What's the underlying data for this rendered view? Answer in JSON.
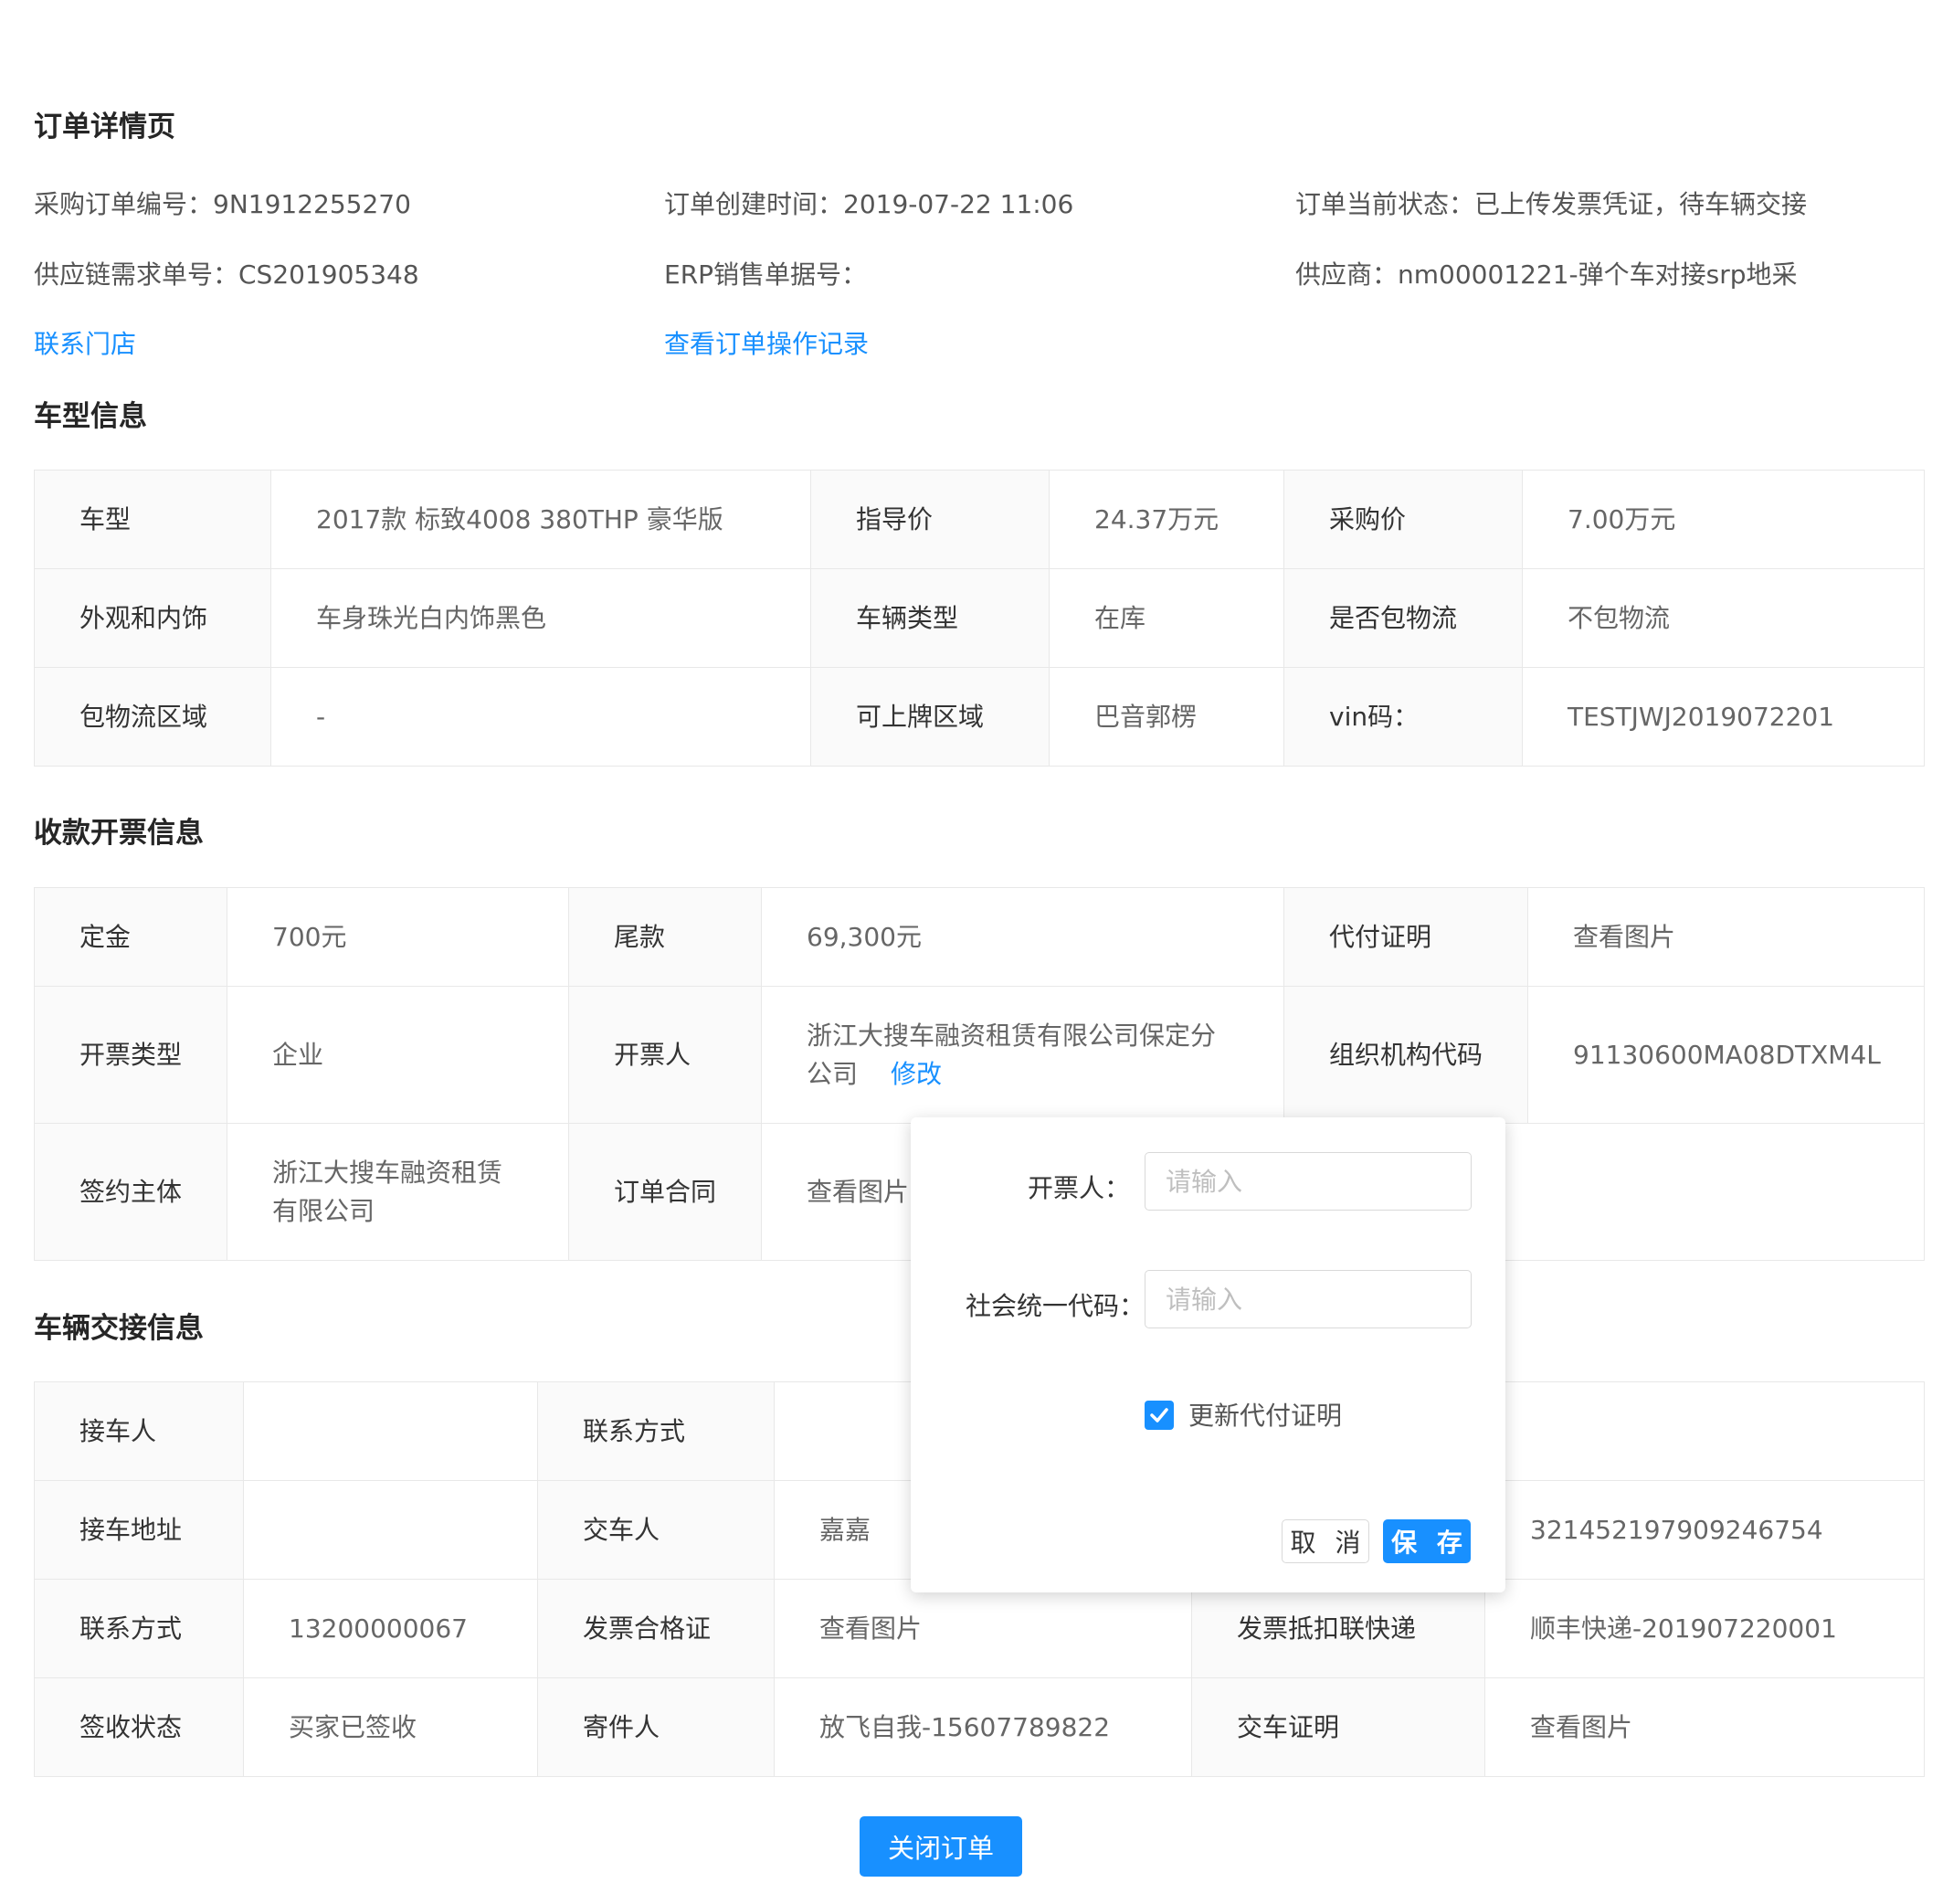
{
  "page": {
    "title": "订单详情页"
  },
  "order": {
    "po_number": "采购订单编号：9N1912255270",
    "created_time": "订单创建时间：2019-07-22 11:06",
    "status": "订单当前状态：已上传发票凭证，待车辆交接",
    "supply_chain_number": "供应链需求单号：CS201905348",
    "erp_number": "ERP销售单据号：",
    "supplier": "供应商：nm00001221-弹个车对接srp地采",
    "contact_store_link": "联系门店",
    "view_log_link": "查看订单操作记录"
  },
  "vehicle": {
    "title": "车型信息",
    "rows": [
      [
        "车型",
        "2017款 标致4008 380THP 豪华版",
        "指导价",
        "24.37万元",
        "采购价",
        "7.00万元"
      ],
      [
        "外观和内饰",
        "车身珠光白内饰黑色",
        "车辆类型",
        "在库",
        "是否包物流",
        "不包物流"
      ],
      [
        "包物流区域",
        "-",
        "可上牌区域",
        "巴音郭楞",
        "vin码：",
        "TESTJWJ2019072201"
      ]
    ]
  },
  "payment": {
    "title": "收款开票信息",
    "deposit_label": "定金",
    "deposit_value": "700元",
    "balance_label": "尾款",
    "balance_value": "69,300元",
    "proxy_label": "代付证明",
    "proxy_value": "查看图片",
    "invoice_type_label": "开票类型",
    "invoice_type_value": "企业",
    "issuer_label": "开票人",
    "issuer_value": "浙江大搜车融资租赁有限公司保定分公司",
    "issuer_edit": "修改",
    "org_code_label": "组织机构代码",
    "org_code_value": "91130600MA08DTXM4L",
    "signer_label": "签约主体",
    "signer_value": "浙江大搜车融资租赁有限公司",
    "contract_label": "订单合同",
    "contract_value": "查看图片"
  },
  "handover": {
    "title": "车辆交接信息",
    "receiver_label": "接车人",
    "receiver_value": "",
    "contact_label": "联系方式",
    "contact_value": "",
    "address_label": "接车地址",
    "address_value": "",
    "deliverer_label": "交车人",
    "deliverer_value": "嘉嘉",
    "id_value": "321452197909246754",
    "phone_label": "联系方式",
    "phone_value": "13200000067",
    "cert_label": "发票合格证",
    "cert_value": "查看图片",
    "express_label": "发票抵扣联快递",
    "express_value": "顺丰快递-201907220001",
    "sign_status_label": "签收状态",
    "sign_status_value": "买家已签收",
    "sender_label": "寄件人",
    "sender_value": "放飞自我-15607789822",
    "delivery_proof_label": "交车证明",
    "delivery_proof_value": "查看图片"
  },
  "popover": {
    "issuer_label": "开票人：",
    "issuer_placeholder": "请输入",
    "code_label": "社会统一代码：",
    "code_placeholder": "请输入",
    "checkbox_label": "更新代付证明",
    "checkbox_checked": true,
    "cancel_label": "取 消",
    "save_label": "保 存"
  },
  "footer": {
    "close_order_label": "关闭订单"
  },
  "colors": {
    "primary": "#1890ff",
    "border": "#e8e8e8",
    "label_bg": "#fafafa"
  }
}
